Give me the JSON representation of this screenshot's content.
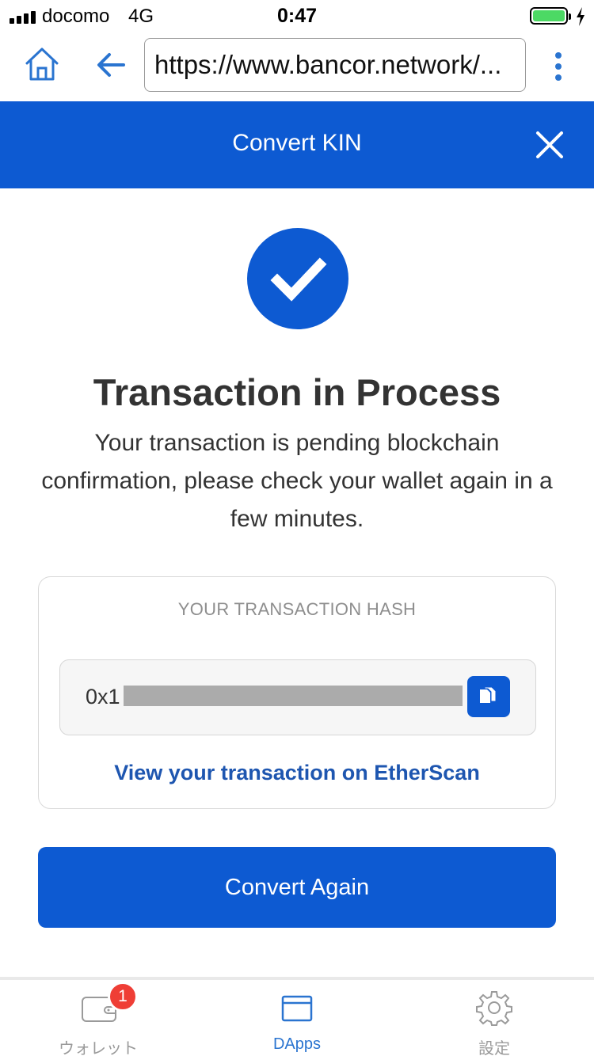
{
  "status_bar": {
    "carrier": "docomo",
    "network": "4G",
    "time": "0:47"
  },
  "browser": {
    "url": "https://www.bancor.network/..."
  },
  "header": {
    "title": "Convert KIN"
  },
  "content": {
    "title": "Transaction in Process",
    "description": "Your transaction is pending blockchain confirmation, please check your wallet again in a few minutes.",
    "hash_label": "YOUR TRANSACTION HASH",
    "hash_prefix": "0x1",
    "etherscan_link": "View your transaction on EtherScan",
    "convert_again": "Convert Again"
  },
  "tabbar": {
    "tabs": [
      {
        "label": "ウォレット",
        "icon": "wallet-icon",
        "badge": "1",
        "active": false
      },
      {
        "label": "DApps",
        "icon": "dapps-icon",
        "active": true
      },
      {
        "label": "設定",
        "icon": "gear-icon",
        "active": false
      }
    ]
  },
  "colors": {
    "brand_blue": "#0d5ad2",
    "link_blue": "#1e56b0",
    "active_tab": "#2a74d0",
    "inactive_tab": "#9a9a9a",
    "badge_red": "#ef3e36",
    "battery_green": "#4cd964"
  }
}
